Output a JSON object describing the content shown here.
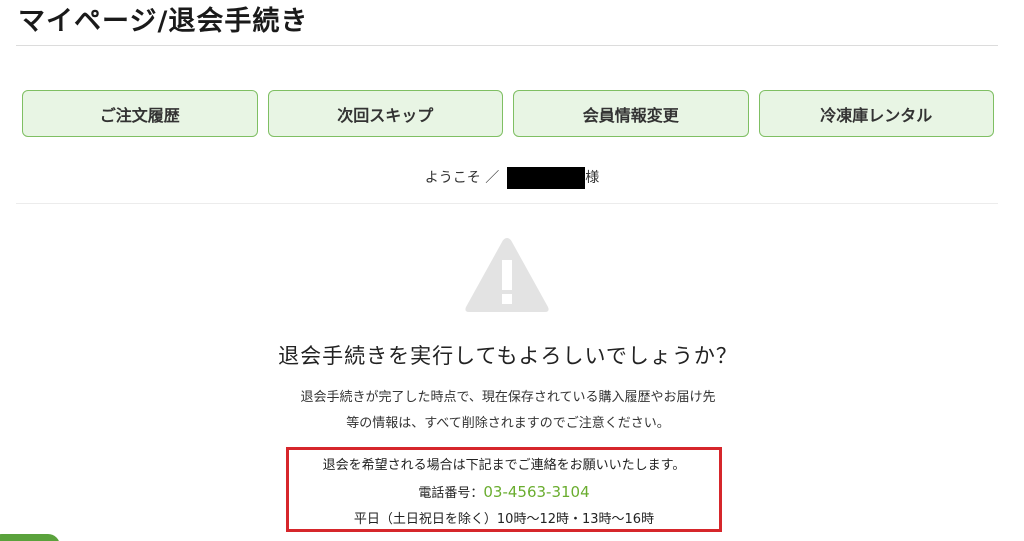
{
  "header": {
    "title": "マイページ/退会手続き"
  },
  "nav": {
    "items": [
      {
        "label": "ご注文履歴"
      },
      {
        "label": "次回スキップ"
      },
      {
        "label": "会員情報変更"
      },
      {
        "label": "冷凍庫レンタル"
      }
    ]
  },
  "welcome": {
    "prefix": "ようこそ ／",
    "suffix": "様"
  },
  "confirm": {
    "icon": "warning-icon",
    "question": "退会手続きを実行してもよろしいでしょうか？",
    "notice_line1": "退会手続きが完了した時点で、現在保存されている購入履歴やお届け先",
    "notice_line2": "等の情報は、すべて削除されますのでご注意ください。"
  },
  "contact": {
    "line1": "退会を希望される場合は下記までご連絡をお願いいたします。",
    "phone_label": "電話番号：",
    "phone_number": "03-4563-3104",
    "hours": "平日（土日祝日を除く）10時〜12時・13時〜16時"
  },
  "colors": {
    "nav_bg": "#e8f5e4",
    "nav_border": "#7fbf63",
    "phone": "#6aad2f",
    "highlight_border": "#d6262b",
    "icon": "#e3e3e3"
  }
}
